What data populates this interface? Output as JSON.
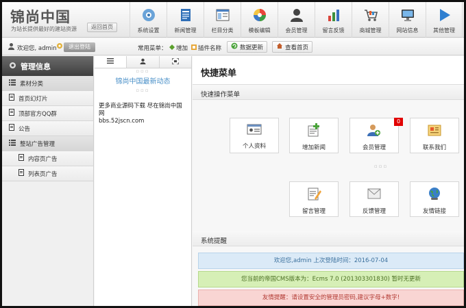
{
  "header": {
    "logo": "锦尚中国",
    "slogan": "为站长提供最好的建站资源",
    "home_button": "返回首页",
    "nav": [
      {
        "label": "系统设置",
        "icon": "gear-icon"
      },
      {
        "label": "新闻管理",
        "icon": "news-icon"
      },
      {
        "label": "栏目分类",
        "icon": "columns-icon"
      },
      {
        "label": "模板编辑",
        "icon": "palette-icon"
      },
      {
        "label": "会员管理",
        "icon": "member-icon"
      },
      {
        "label": "留言反馈",
        "icon": "chart-icon"
      },
      {
        "label": "商城管理",
        "icon": "cart-icon"
      },
      {
        "label": "网站信息",
        "icon": "monitor-icon"
      },
      {
        "label": "其他管理",
        "icon": "play-icon"
      }
    ]
  },
  "toolbar": {
    "welcome": "欢迎您, admin",
    "logout": "退出登陆",
    "quick_label": "常用菜单：",
    "add": "增加",
    "plugin": "插件名称",
    "refresh": "数据更新",
    "view_home": "查看首页"
  },
  "sidebar": {
    "title": "管理信息",
    "items": [
      {
        "label": "素材分类"
      },
      {
        "label": "首页幻灯片"
      },
      {
        "label": "顶部官方QQ群"
      },
      {
        "label": "公告"
      },
      {
        "label": "整站广告管理"
      },
      {
        "label": "内容页广告"
      },
      {
        "label": "列表页广告"
      }
    ]
  },
  "midpanel": {
    "heading": "锦尚中国最新动态",
    "text_line1": "更多商业源码下载 尽在锦尚中国网",
    "text_line2": "bbs.52jscn.com"
  },
  "content": {
    "title": "快捷菜单",
    "quick_section": "快速操作菜单",
    "tiles": [
      {
        "label": "个人资料",
        "icon": "profile-card-icon"
      },
      {
        "label": "增加新闻",
        "icon": "add-news-icon"
      },
      {
        "label": "会员管理",
        "icon": "members-icon",
        "badge": "0"
      },
      {
        "label": "联系我们",
        "icon": "contact-icon"
      },
      {
        "label": "留言管理",
        "icon": "message-edit-icon"
      },
      {
        "label": "反馈管理",
        "icon": "feedback-icon"
      },
      {
        "label": "友情链接",
        "icon": "globe-link-icon"
      }
    ],
    "notice_section": "系统提醒",
    "alerts": {
      "info": "欢迎您,admin 上次登陆时间：2016-07-04",
      "success": "您当前的帝国CMS版本为：Ecms 7.0 (201303301830) 暂时无更新",
      "danger": "友情提醒：请设置安全的管理员密码,建议字母+数字!"
    }
  },
  "colors": {
    "badge": "#e10000",
    "link_blue": "#4a90c8",
    "sidebar_header": "#4a4a4a"
  }
}
